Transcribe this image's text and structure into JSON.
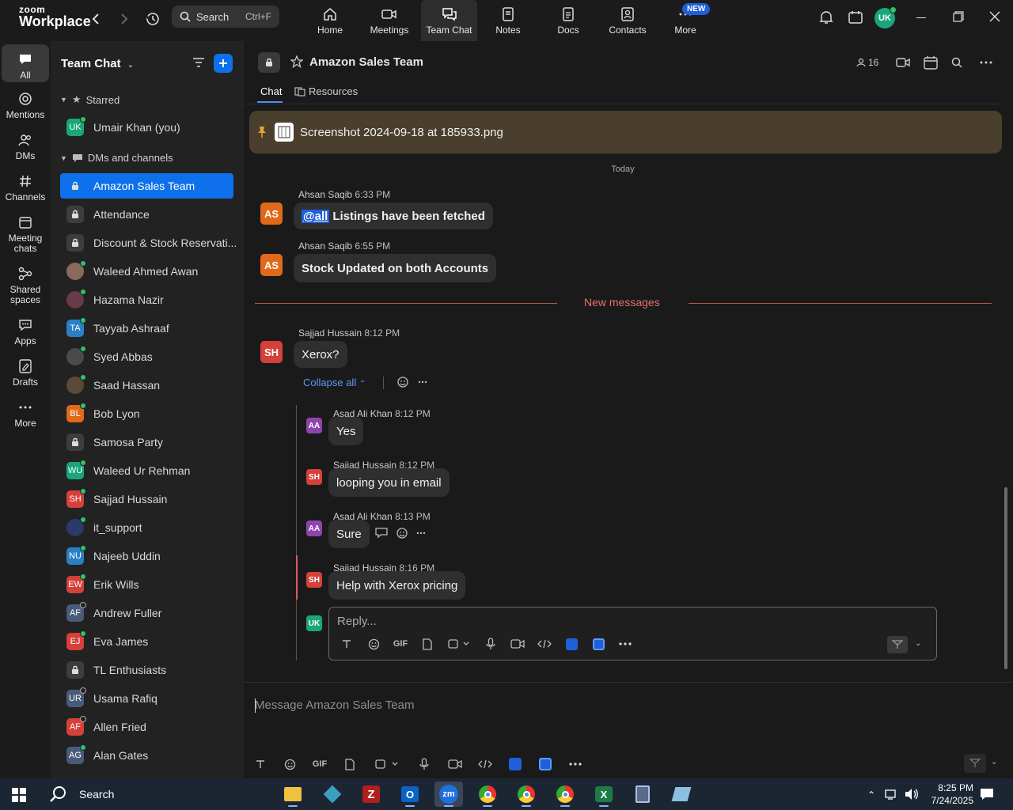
{
  "app": {
    "brand_top": "zoom",
    "brand_bottom": "Workplace"
  },
  "search": {
    "label": "Search",
    "shortcut": "Ctrl+F"
  },
  "nav": [
    {
      "label": "Home",
      "icon": "home-icon"
    },
    {
      "label": "Meetings",
      "icon": "video-icon"
    },
    {
      "label": "Team Chat",
      "icon": "chat-icon"
    },
    {
      "label": "Notes",
      "icon": "notes-icon"
    },
    {
      "label": "Docs",
      "icon": "docs-icon"
    },
    {
      "label": "Contacts",
      "icon": "contacts-icon"
    },
    {
      "label": "More",
      "icon": "more-icon"
    }
  ],
  "new_badge": "NEW",
  "user": {
    "initials": "UK",
    "color": "#1aa67a"
  },
  "rail": [
    {
      "label": "All"
    },
    {
      "label": "Mentions"
    },
    {
      "label": "DMs"
    },
    {
      "label": "Channels"
    },
    {
      "label": "Meeting chats"
    },
    {
      "label": "Shared spaces"
    },
    {
      "label": "Apps"
    },
    {
      "label": "Drafts"
    },
    {
      "label": "More"
    }
  ],
  "sidebar": {
    "title": "Team Chat",
    "starred_label": "Starred",
    "starred": [
      {
        "name": "Umair Khan (you)",
        "initials": "UK",
        "color": "#1aa67a"
      }
    ],
    "dms_label": "DMs and channels",
    "items": [
      {
        "name": "Amazon Sales Team",
        "type": "lock",
        "active": true
      },
      {
        "name": "Attendance",
        "type": "lock"
      },
      {
        "name": "Discount & Stock Reservati...",
        "type": "lock"
      },
      {
        "name": "Waleed Ahmed Awan",
        "type": "photo",
        "color": "#8a6a5a"
      },
      {
        "name": "Hazama Nazir",
        "type": "photo",
        "color": "#6a3a4a"
      },
      {
        "name": "Tayyab Ashraaf",
        "initials": "TA",
        "color": "#2b7fc7"
      },
      {
        "name": "Syed Abbas",
        "type": "photo",
        "color": "#4a4a4a"
      },
      {
        "name": "Saad Hassan",
        "type": "photo",
        "color": "#5a4a3a"
      },
      {
        "name": "Bob Lyon",
        "initials": "BL",
        "color": "#e06a1a"
      },
      {
        "name": "Samosa Party",
        "type": "lock"
      },
      {
        "name": "Waleed Ur Rehman",
        "initials": "WU",
        "color": "#1aa67a"
      },
      {
        "name": "Sajjad Hussain",
        "initials": "SH",
        "color": "#d6403a"
      },
      {
        "name": "it_support",
        "type": "photo",
        "color": "#2a3a6a"
      },
      {
        "name": "Najeeb Uddin",
        "initials": "NU",
        "color": "#2b7fc7"
      },
      {
        "name": "Erik Wills",
        "initials": "EW",
        "color": "#d6403a"
      },
      {
        "name": "Andrew Fuller",
        "initials": "AF",
        "color": "#4a5a7a",
        "off": true
      },
      {
        "name": "Eva James",
        "initials": "EJ",
        "color": "#d6403a"
      },
      {
        "name": "TL Enthusiasts",
        "type": "lock"
      },
      {
        "name": "Usama Rafiq",
        "initials": "UR",
        "color": "#4a5a7a",
        "off": true
      },
      {
        "name": "Allen Fried",
        "initials": "AF",
        "color": "#d6403a",
        "off": true
      },
      {
        "name": "Alan Gates",
        "initials": "AG",
        "color": "#4a5a7a"
      }
    ]
  },
  "channel": {
    "title": "Amazon Sales Team",
    "members": "16",
    "tabs": [
      "Chat",
      "Resources"
    ],
    "pinned": "Screenshot 2024-09-18 at 185933.png",
    "day_divider": "Today",
    "new_messages": "New messages"
  },
  "messages": [
    {
      "sender": "Ahsan Saqib",
      "time": "6:33 PM",
      "initials": "AS",
      "mention": "@all",
      "text": "Listings have been fetched"
    },
    {
      "sender": "Ahsan Saqib",
      "time": "6:55 PM",
      "initials": "AS",
      "text": "Stock Updated on both Accounts"
    },
    {
      "sender": "Sajjad Hussain",
      "time": "8:12 PM",
      "initials": "SH",
      "text": "Xerox?"
    }
  ],
  "thread": {
    "collapse_label": "Collapse all",
    "replies": [
      {
        "sender": "Asad Ali Khan",
        "time": "8:12 PM",
        "initials": "AA",
        "text": "Yes"
      },
      {
        "sender": "Sajjad Hussain",
        "time": "8:12 PM",
        "initials": "SH",
        "text": "looping you in email"
      },
      {
        "sender": "Asad Ali Khan",
        "time": "8:13 PM",
        "initials": "AA",
        "text": "Sure"
      },
      {
        "sender": "Sajjad Hussain",
        "time": "8:16 PM",
        "initials": "SH",
        "text": "Help with Xerox pricing"
      }
    ],
    "reply_placeholder": "Reply..."
  },
  "composer": {
    "placeholder": "Message Amazon Sales Team",
    "gif_label": "GIF"
  },
  "taskbar": {
    "search_label": "Search",
    "time": "8:25 PM",
    "date": "7/24/2025"
  }
}
